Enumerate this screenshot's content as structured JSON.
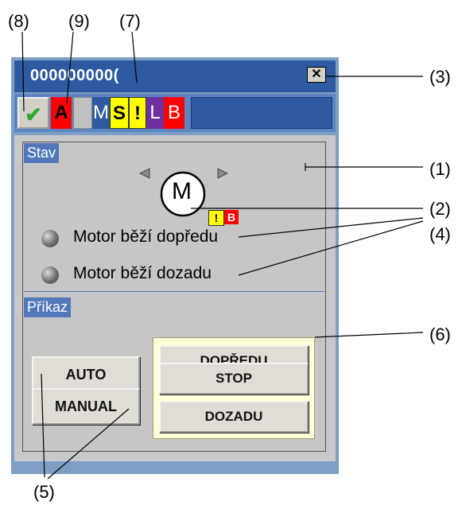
{
  "callouts": {
    "c8": "(8)",
    "c9": "(9)",
    "c7": "(7)",
    "c3": "(3)",
    "c1": "(1)",
    "c2": "(2)",
    "c4": "(4)",
    "c6": "(6)",
    "c5": "(5)"
  },
  "window": {
    "title": "000000000(",
    "close_glyph": "✕"
  },
  "status": {
    "check_glyph": "✔",
    "a": "A",
    "m": "M",
    "s": "S",
    "excl": "!",
    "l": "L",
    "b": "B"
  },
  "stav": {
    "label": "Stav",
    "motor_letter": "M",
    "badge_excl": "!",
    "badge_b": "B",
    "lamp1_text": "Motor běží dopředu",
    "lamp2_text": "Motor běží dozadu"
  },
  "prikaz": {
    "label": "Příkaz",
    "auto": "AUTO",
    "manual": "MANUAL",
    "dopredu": "DOPŘEDU",
    "stop": "STOP",
    "dozadu": "DOZADU"
  },
  "colors": {
    "title_bar": "#2d5aa0",
    "status_red": "#ff0000",
    "status_yellow": "#ffff00",
    "status_purple": "#7030a0",
    "ok_green": "#2fa82f"
  }
}
